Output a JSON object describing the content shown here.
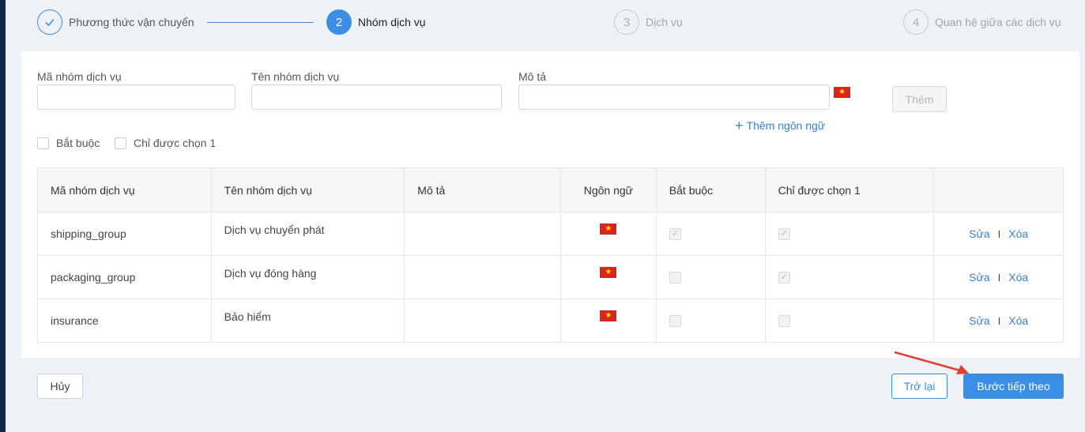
{
  "steps": [
    {
      "number": "✓",
      "label": "Phương thức vận chuyển",
      "state": "done"
    },
    {
      "number": "2",
      "label": "Nhóm dịch vụ",
      "state": "active"
    },
    {
      "number": "3",
      "label": "Dịch vụ",
      "state": "pending"
    },
    {
      "number": "4",
      "label": "Quan hệ giữa các dịch vụ",
      "state": "pending"
    }
  ],
  "form": {
    "code_label": "Mã nhóm dịch vụ",
    "code_value": "",
    "name_label": "Tên nhóm dịch vụ",
    "name_value": "",
    "desc_label": "Mô tả",
    "desc_value": "",
    "add_button": "Thêm",
    "add_language": "Thêm ngôn ngữ",
    "required_label": "Bắt buộc",
    "single_choice_label": "Chỉ được chọn 1"
  },
  "table": {
    "headers": [
      "Mã nhóm dịch vụ",
      "Tên nhóm dịch vụ",
      "Mô tả",
      "Ngôn ngữ",
      "Bắt buộc",
      "Chỉ được chọn 1",
      ""
    ],
    "rows": [
      {
        "code": "shipping_group",
        "name": "Dịch vụ chuyển phát",
        "desc": "",
        "required": true,
        "single": true,
        "edit": "Sửa",
        "delete": "Xóa"
      },
      {
        "code": "packaging_group",
        "name": "Dịch vụ đóng hàng",
        "desc": "",
        "required": false,
        "single": true,
        "edit": "Sửa",
        "delete": "Xóa"
      },
      {
        "code": "insurance",
        "name": "Bảo hiểm",
        "desc": "",
        "required": false,
        "single": false,
        "edit": "Sửa",
        "delete": "Xóa"
      }
    ],
    "separator": "I"
  },
  "footer": {
    "cancel": "Hủy",
    "back": "Trở lại",
    "next": "Bước tiếp theo"
  },
  "colors": {
    "primary": "#3a8ee6",
    "link": "#3a7fc9",
    "sidebar": "#13234a",
    "flag_red": "#da251d",
    "flag_star": "#ffde00",
    "annotation_arrow": "#e0402e"
  },
  "icons": {
    "language_flag": "vietnam-flag-icon",
    "done_step": "check-icon",
    "add": "plus-icon",
    "annotation": "red-arrow-icon"
  }
}
